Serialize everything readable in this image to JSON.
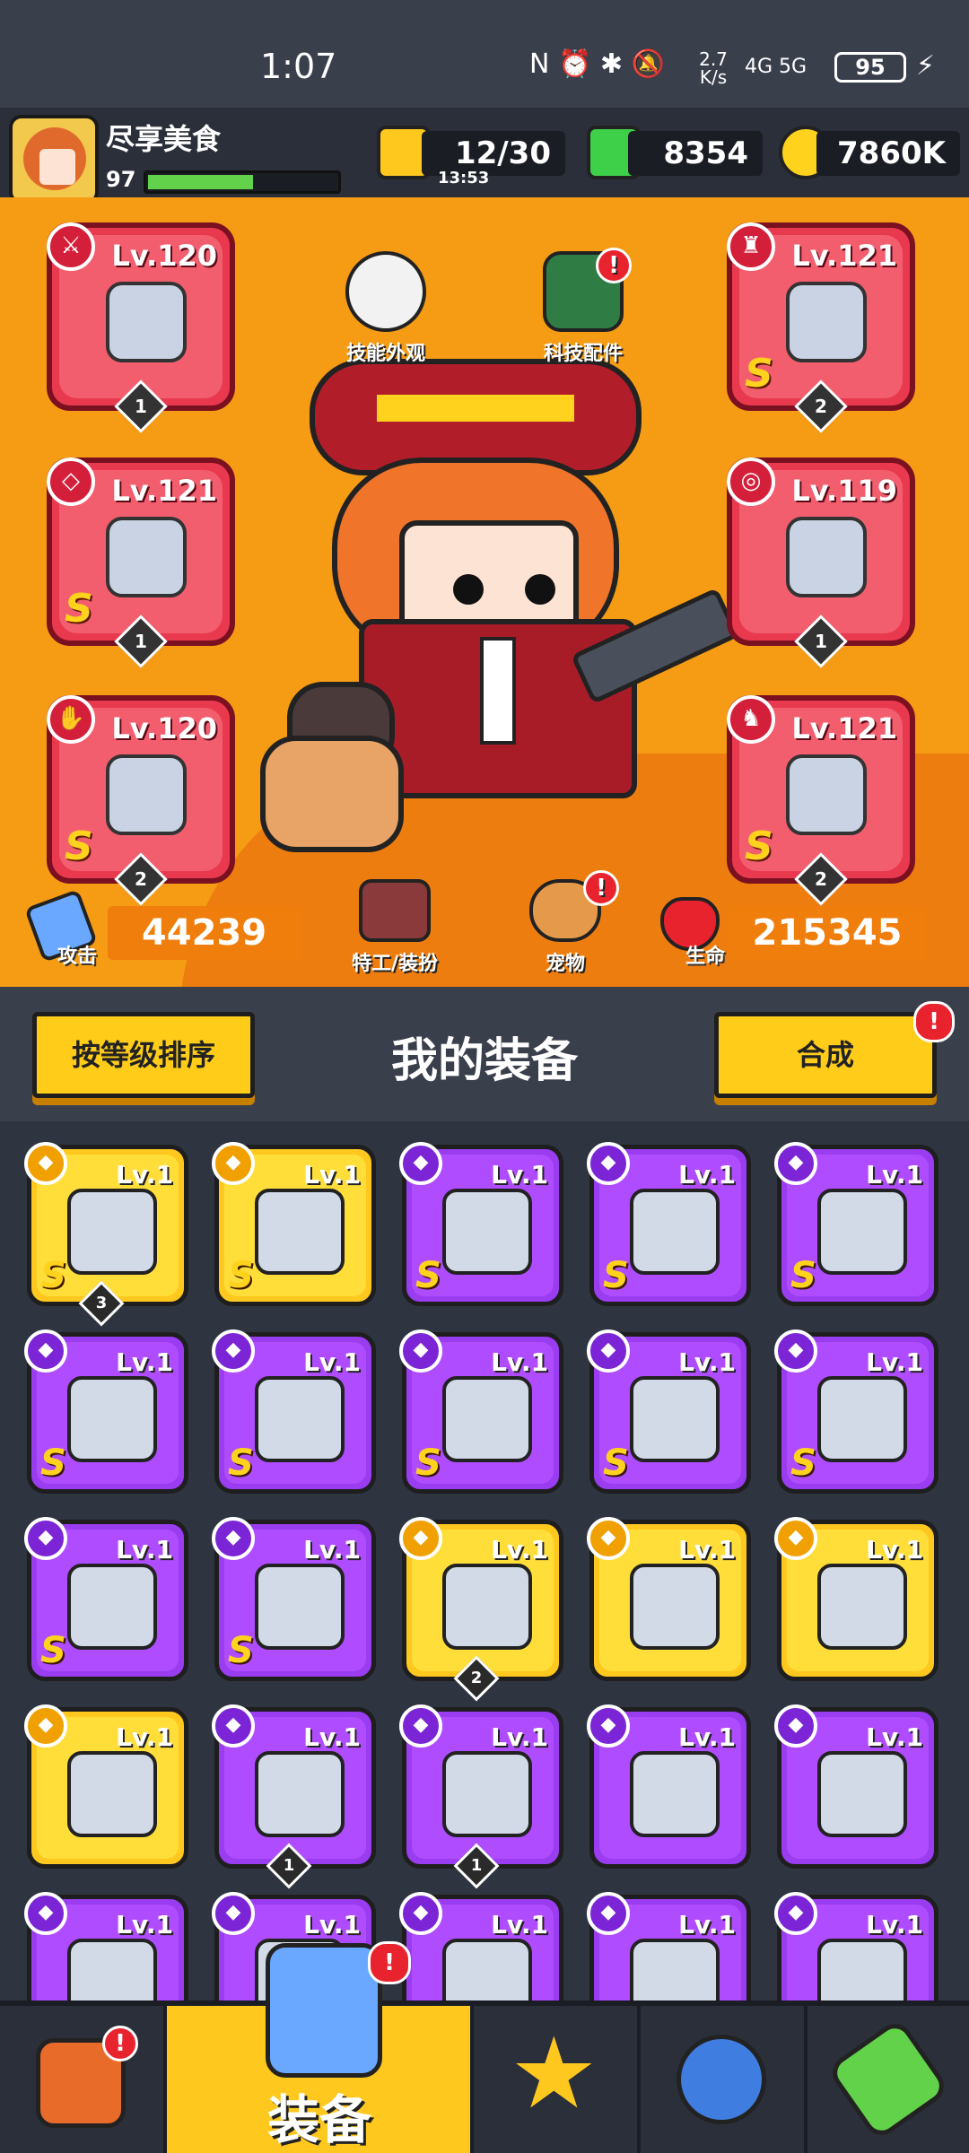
{
  "status_bar": {
    "time": "1:07",
    "net_speed": "2.7\nK/s",
    "indicators": "N ⏰ ✱ 🔕",
    "signal": "4G 5G",
    "battery": "95"
  },
  "player": {
    "name": "尽享美食",
    "level": "97",
    "xp_fraction": 0.55
  },
  "resources": {
    "energy": "12/30",
    "energy_timer": "13:53",
    "gems": "8354",
    "gold": "7860K"
  },
  "hero_buttons": {
    "skin": "技能外观",
    "tech": "科技配件",
    "agent": "特工/装扮",
    "pet": "宠物"
  },
  "equipped": [
    {
      "lv": "Lv.120",
      "rarity": "",
      "count": "1",
      "icon": "kunai-icon",
      "type_icon": "weapon-icon"
    },
    {
      "lv": "Lv.121",
      "rarity": "S",
      "count": "2",
      "icon": "armor-icon",
      "type_icon": "armor-icon"
    },
    {
      "lv": "Lv.121",
      "rarity": "S",
      "count": "1",
      "icon": "necklace-icon",
      "type_icon": "necklace-icon"
    },
    {
      "lv": "Lv.119",
      "rarity": "",
      "count": "1",
      "icon": "belt-icon",
      "type_icon": "belt-icon"
    },
    {
      "lv": "Lv.120",
      "rarity": "S",
      "count": "2",
      "icon": "glove-icon",
      "type_icon": "glove-icon"
    },
    {
      "lv": "Lv.121",
      "rarity": "S",
      "count": "2",
      "icon": "boot-icon",
      "type_icon": "boot-icon"
    }
  ],
  "stats": {
    "attack_label": "攻击",
    "attack": "44239",
    "hp_label": "生命",
    "hp": "215345"
  },
  "equipment_panel": {
    "sort_button": "按等级排序",
    "title": "我的装备",
    "merge_button": "合成"
  },
  "inventory": [
    {
      "lv": "Lv.1",
      "rarity": "S",
      "tier": "gold",
      "count": "3",
      "icon": "sword-icon"
    },
    {
      "lv": "Lv.1",
      "rarity": "S",
      "tier": "gold",
      "count": "",
      "icon": "sword-icon"
    },
    {
      "lv": "Lv.1",
      "rarity": "S",
      "tier": "purple",
      "count": "",
      "icon": "gun-icon"
    },
    {
      "lv": "Lv.1",
      "rarity": "S",
      "tier": "purple",
      "count": "",
      "icon": "gun-icon"
    },
    {
      "lv": "Lv.1",
      "rarity": "S",
      "tier": "purple",
      "count": "",
      "icon": "shuriken-icon"
    },
    {
      "lv": "Lv.1",
      "rarity": "S",
      "tier": "purple",
      "count": "",
      "icon": "armor-icon"
    },
    {
      "lv": "Lv.1",
      "rarity": "S",
      "tier": "purple",
      "count": "",
      "icon": "necklace-icon"
    },
    {
      "lv": "Lv.1",
      "rarity": "S",
      "tier": "purple",
      "count": "",
      "icon": "necklace-icon"
    },
    {
      "lv": "Lv.1",
      "rarity": "S",
      "tier": "purple",
      "count": "",
      "icon": "chain-necklace-icon"
    },
    {
      "lv": "Lv.1",
      "rarity": "S",
      "tier": "purple",
      "count": "",
      "icon": "belt-icon"
    },
    {
      "lv": "Lv.1",
      "rarity": "S",
      "tier": "purple",
      "count": "",
      "icon": "glove-icon"
    },
    {
      "lv": "Lv.1",
      "rarity": "S",
      "tier": "purple",
      "count": "",
      "icon": "boot-icon"
    },
    {
      "lv": "Lv.1",
      "rarity": "",
      "tier": "gold",
      "count": "2",
      "icon": "spiked-collar-icon"
    },
    {
      "lv": "Lv.1",
      "rarity": "",
      "tier": "gold",
      "count": "",
      "icon": "spiked-collar-icon"
    },
    {
      "lv": "Lv.1",
      "rarity": "",
      "tier": "gold",
      "count": "",
      "icon": "spiked-collar-icon"
    },
    {
      "lv": "Lv.1",
      "rarity": "",
      "tier": "gold",
      "count": "",
      "icon": "glove-icon"
    },
    {
      "lv": "Lv.1",
      "rarity": "",
      "tier": "purple",
      "count": "1",
      "icon": "spiked-collar-icon"
    },
    {
      "lv": "Lv.1",
      "rarity": "",
      "tier": "purple",
      "count": "1",
      "icon": "spiked-collar-icon"
    },
    {
      "lv": "Lv.1",
      "rarity": "",
      "tier": "purple",
      "count": "",
      "icon": "kunai-icon"
    },
    {
      "lv": "Lv.1",
      "rarity": "",
      "tier": "purple",
      "count": "",
      "icon": "sabre-icon"
    },
    {
      "lv": "Lv.1",
      "rarity": "",
      "tier": "purple",
      "count": "",
      "icon": "gun-icon"
    },
    {
      "lv": "Lv.1",
      "rarity": "",
      "tier": "purple",
      "count": "",
      "icon": "shield-icon"
    },
    {
      "lv": "Lv.1",
      "rarity": "",
      "tier": "purple",
      "count": "",
      "icon": "armor-icon"
    },
    {
      "lv": "Lv.1",
      "rarity": "",
      "tier": "purple",
      "count": "",
      "icon": "armor-icon"
    },
    {
      "lv": "Lv.1",
      "rarity": "",
      "tier": "purple",
      "count": "",
      "icon": "armor-icon"
    }
  ],
  "bottom_nav": {
    "shop_icon": "shop-icon",
    "equipment_label": "装备",
    "battle_icon": "battle-star-icon",
    "events_icon": "events-ball-icon",
    "evolve_icon": "dna-icon"
  },
  "colors": {
    "hero_bg": "#f59b14",
    "slot_red": "#e8394f",
    "item_purple": "#9a3cf0",
    "item_gold": "#ffc81e",
    "alert_red": "#e8232e"
  }
}
